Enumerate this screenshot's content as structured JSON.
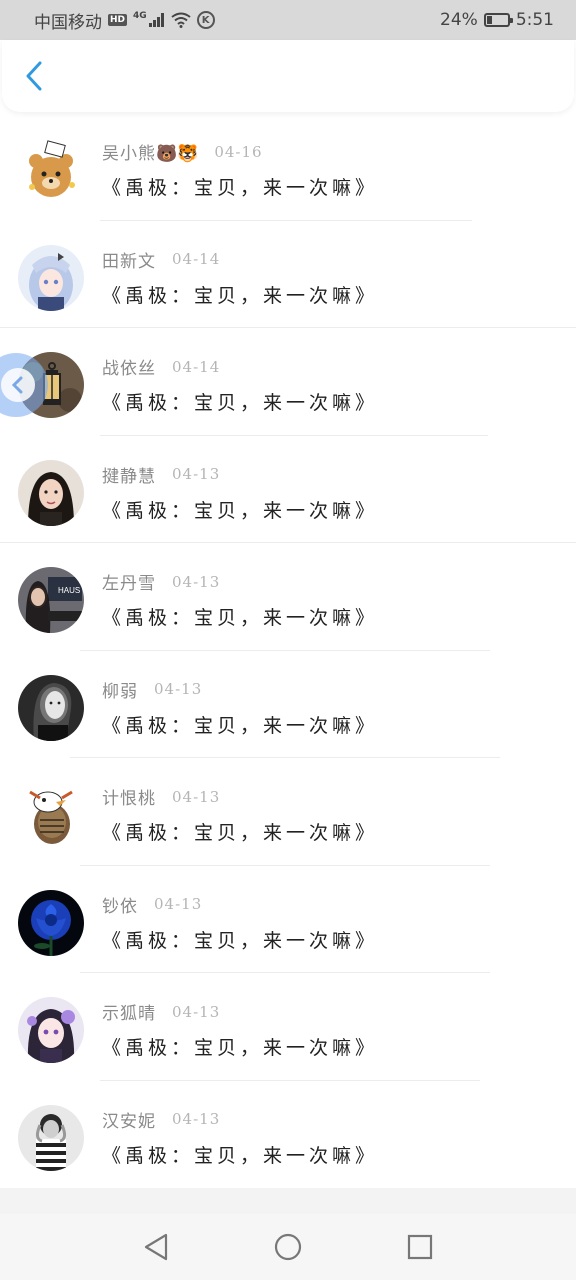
{
  "status_bar": {
    "carrier": "中国移动",
    "hd_badge": "HD",
    "network_label": "4G",
    "battery_percent": "24%",
    "battery_level": 0.24,
    "time": "5:51",
    "icons": [
      "signal-icon",
      "wifi-icon",
      "k-app-icon",
      "battery-icon"
    ]
  },
  "header": {
    "back_icon": "chevron-left-icon",
    "accent_color": "#2f9ae0"
  },
  "messages": [
    {
      "name": "吴小熊",
      "emoji": "🐻🐯",
      "date": "04-16",
      "text": "《禹极：宝贝，来一次嘛》",
      "avatar": "cartoon-bear-avatar"
    },
    {
      "name": "田新文",
      "emoji": "",
      "date": "04-14",
      "text": "《禹极：宝贝，来一次嘛》",
      "avatar": "anime-girl-avatar"
    },
    {
      "name": "战依丝",
      "emoji": "",
      "date": "04-14",
      "text": "《禹极：宝贝，来一次嘛》",
      "avatar": "lantern-avatar"
    },
    {
      "name": "揵静慧",
      "emoji": "",
      "date": "04-13",
      "text": "《禹极：宝贝，来一次嘛》",
      "avatar": "girl-photo-avatar"
    },
    {
      "name": "左丹雪",
      "emoji": "",
      "date": "04-13",
      "text": "《禹极：宝贝，来一次嘛》",
      "avatar": "girl-sign-avatar"
    },
    {
      "name": "柳弱",
      "emoji": "",
      "date": "04-13",
      "text": "《禹极：宝贝，来一次嘛》",
      "avatar": "bw-portrait-avatar"
    },
    {
      "name": "计恨桃",
      "emoji": "",
      "date": "04-13",
      "text": "《禹极：宝贝，来一次嘛》",
      "avatar": "cartoon-bird-avatar"
    },
    {
      "name": "钞依",
      "emoji": "",
      "date": "04-13",
      "text": "《禹极：宝贝，来一次嘛》",
      "avatar": "blue-rose-avatar"
    },
    {
      "name": "示狐晴",
      "emoji": "",
      "date": "04-13",
      "text": "《禹极：宝贝，来一次嘛》",
      "avatar": "anime-purple-avatar"
    },
    {
      "name": "汉安妮",
      "emoji": "",
      "date": "04-13",
      "text": "《禹极：宝贝，来一次嘛》",
      "avatar": "striped-shirt-avatar"
    }
  ],
  "nav": {
    "back": "triangle-back-icon",
    "home": "circle-home-icon",
    "recent": "square-recent-icon"
  }
}
